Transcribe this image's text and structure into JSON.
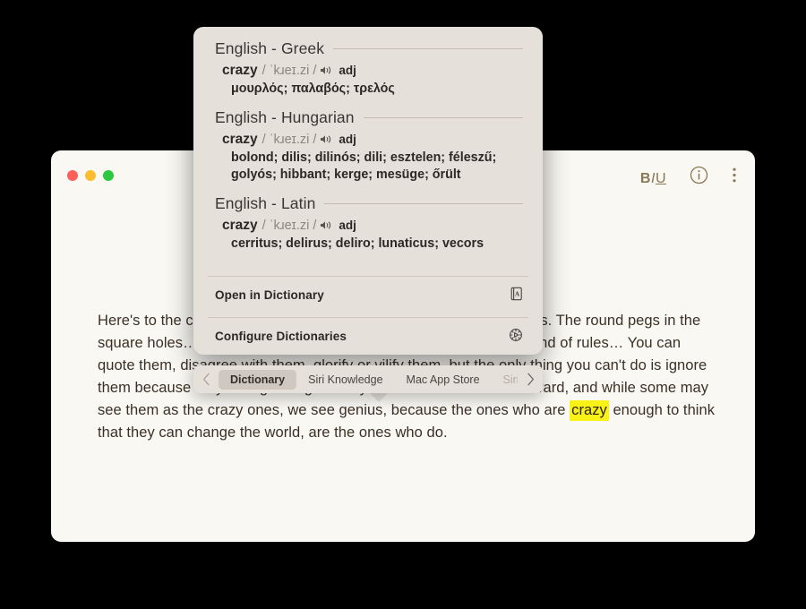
{
  "window": {
    "traffic_lights": [
      {
        "name": "close",
        "color": "#fc6058"
      },
      {
        "name": "minimize",
        "color": "#fdbc2f"
      },
      {
        "name": "maximize",
        "color": "#2bc840"
      }
    ],
    "toolbar": {
      "format_bold": "B",
      "format_italic": "I",
      "format_underline": "U",
      "info_label": "i",
      "more_label": "⋮"
    },
    "body_color": "#faf8f3",
    "text_color": "#3b3026"
  },
  "document": {
    "paragraph_before": "Here's to the crazy ones. The misfits. The rebels. The troublemakers. The round pegs in the square holes… the ones who see things differently — they're not fond of rules… You can quote them, disagree with them, glorify or vilify them, but the only thing you can't do is ignore them because they change things… they push the human race forward, and while some may see them as the crazy ones, we see genius, because the ones who are ",
    "highlighted_word": "crazy",
    "paragraph_after": " enough to think that they can change the world, are the ones who do.",
    "highlight_color": "#faf216"
  },
  "popover": {
    "sections": [
      {
        "title": "English - Greek",
        "headword": "crazy",
        "ipa": "/ ˈkɹeɪ.zi /",
        "pos": "adj",
        "senses": [
          "μουρλός; παλαβός; τρελός"
        ]
      },
      {
        "title": "English - Hungarian",
        "headword": "crazy",
        "ipa": "/ ˈkɹeɪ.zi /",
        "pos": "adj",
        "senses": [
          "bolond; dilis; dilinós; dili; esztelen; féleszű;",
          "golyós; hibbant; kerge; mesüge; őrült"
        ]
      },
      {
        "title": "English - Latin",
        "headword": "crazy",
        "ipa": "/ ˈkɹeɪ.zi /",
        "pos": "adj",
        "senses": [
          "cerritus; delirus; deliro; lunaticus; vecors"
        ]
      }
    ],
    "actions": [
      {
        "label": "Open in Dictionary",
        "icon": "dictionary-book-icon"
      },
      {
        "label": "Configure Dictionaries",
        "icon": "gear-play-icon"
      }
    ],
    "background": "#e6e0da"
  },
  "tabbar": {
    "prev_label": "‹",
    "next_label": "›",
    "tabs": [
      {
        "label": "Dictionary",
        "selected": true,
        "faded": false
      },
      {
        "label": "Siri Knowledge",
        "selected": false,
        "faded": false
      },
      {
        "label": "Mac App Store",
        "selected": false,
        "faded": false
      },
      {
        "label": "Siri Sug",
        "selected": false,
        "faded": true
      }
    ]
  }
}
